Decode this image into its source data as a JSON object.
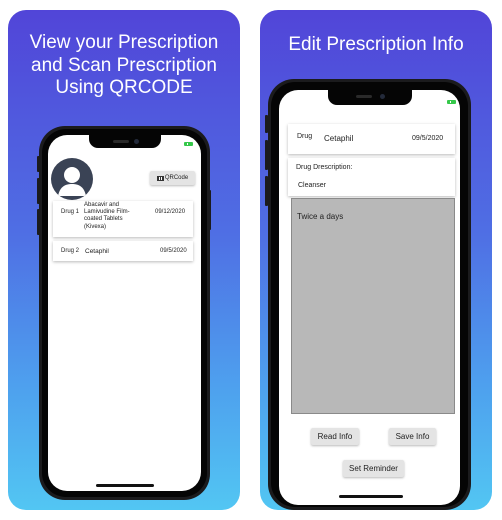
{
  "left_panel": {
    "headline_lines": [
      "View your Prescription",
      "and Scan Prescription",
      "Using QRCODE"
    ],
    "qrcode_button": "QRCode",
    "drugs": [
      {
        "label": "Drug 1",
        "name_lines": [
          "Abacavir and",
          "Lamivudine Film-",
          "coated Tablets",
          "(Kivexa)"
        ],
        "date": "09/12/2020"
      },
      {
        "label": "Drug 2",
        "name_lines": [
          "Cetaphil"
        ],
        "date": "09/5/2020"
      }
    ]
  },
  "right_panel": {
    "headline": "Edit Prescription Info",
    "drug_label": "Drug",
    "drug_name": "Cetaphil",
    "drug_date": "09/5/2020",
    "description_label": "Drug Drescription:",
    "description_value": "Cleanser",
    "notes_text": "Twice a days",
    "read_button": "Read Info",
    "save_button": "Save Info",
    "reminder_button": "Set Reminder"
  },
  "colors": {
    "gradient_top": "#5145d8",
    "gradient_bottom": "#52c6f3",
    "battery": "#35c84a",
    "notes_bg": "#b8b8b8"
  },
  "icons": [
    "avatar-icon",
    "qrcode-icon",
    "battery-icon"
  ]
}
